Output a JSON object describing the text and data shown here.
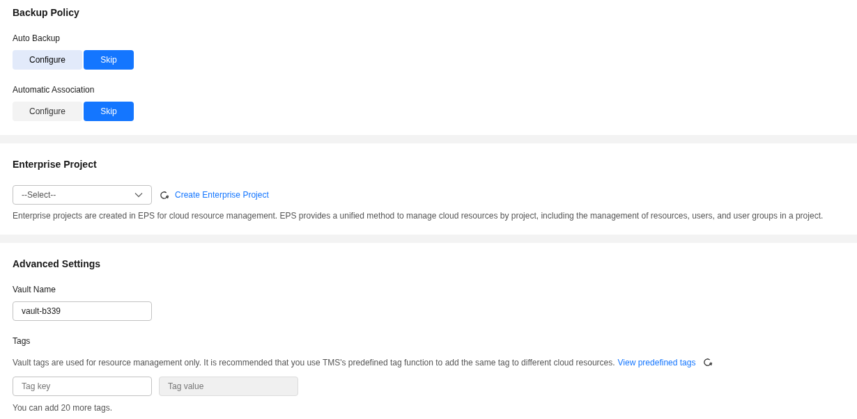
{
  "backup_policy": {
    "title": "Backup Policy",
    "groups": [
      {
        "label": "Auto Backup",
        "options": [
          {
            "label": "Configure",
            "selected": false,
            "hovered": true
          },
          {
            "label": "Skip",
            "selected": true,
            "hovered": false
          }
        ]
      },
      {
        "label": "Automatic Association",
        "options": [
          {
            "label": "Configure",
            "selected": false,
            "hovered": false
          },
          {
            "label": "Skip",
            "selected": true,
            "hovered": false
          }
        ]
      }
    ]
  },
  "enterprise_project": {
    "title": "Enterprise Project",
    "select": {
      "placeholder": "--Select--"
    },
    "create_link": "Create Enterprise Project",
    "description": "Enterprise projects are created in EPS for cloud resource management. EPS provides a unified method to manage cloud resources by project, including the management of resources, users, and user groups in a project."
  },
  "advanced_settings": {
    "title": "Advanced Settings",
    "vault_name": {
      "label": "Vault Name",
      "value": "vault-b339"
    },
    "tags": {
      "label": "Tags",
      "description": "Vault tags are used for resource management only. It is recommended that you use TMS's predefined tag function to add the same tag to different cloud resources.",
      "link": "View predefined tags",
      "key_field": {
        "placeholder": "Tag key",
        "disabled": false
      },
      "value_field": {
        "placeholder": "Tag value",
        "disabled": true
      },
      "note": "You can add 20 more tags."
    }
  }
}
